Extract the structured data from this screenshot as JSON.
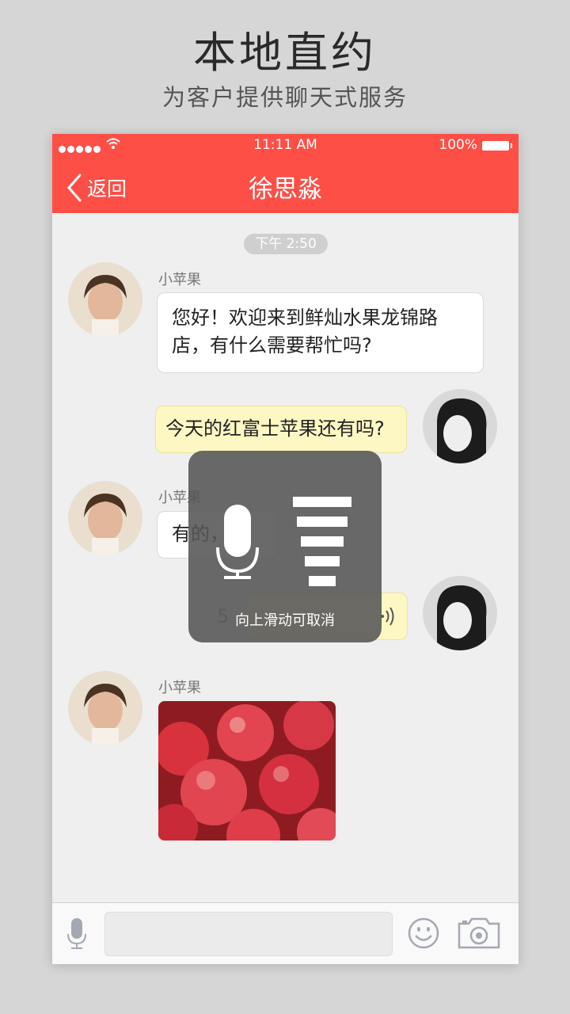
{
  "promo": {
    "title": "本地直约",
    "subtitle": "为客户提供聊天式服务"
  },
  "status_bar": {
    "time": "11:11 AM",
    "battery": "100%"
  },
  "nav": {
    "back_label": "返回",
    "title": "徐思淼"
  },
  "chat": {
    "timestamp": "下午 2:50",
    "messages": [
      {
        "sender": "小苹果",
        "text": "您好！欢迎来到鲜灿水果龙锦路店，有什么需要帮忙吗?"
      },
      {
        "sender": "",
        "text": "今天的红富士苹果还有吗?"
      },
      {
        "sender": "小苹果",
        "text": "有的，"
      },
      {
        "sender": "",
        "text": "5"
      },
      {
        "sender": "小苹果",
        "text": ""
      }
    ]
  },
  "record_overlay": {
    "hint": "向上滑动可取消",
    "level": 1.0
  },
  "input_bar": {
    "placeholder": ""
  },
  "colors": {
    "header": "#fe4f47",
    "background": "#efefef",
    "outgoing_bubble": "#fdf7c4"
  }
}
